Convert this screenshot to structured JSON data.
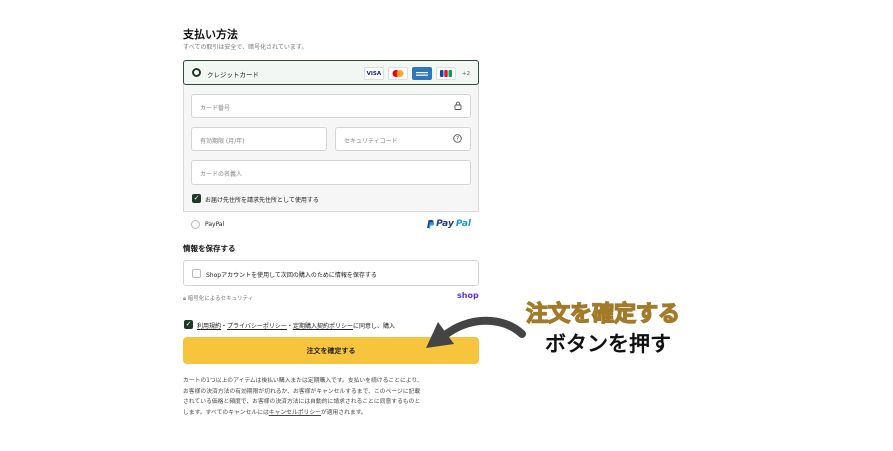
{
  "payment": {
    "title": "支払い方法",
    "subtitle": "すべての取引は安全で、暗号化されています。",
    "credit_card_label": "クレジットカード",
    "card_logos": [
      "VISA",
      "MC",
      "AMEX",
      "JCB"
    ],
    "more_cards": "+2",
    "card_number_placeholder": "カード番号",
    "expiry_placeholder": "有効期限 (月/年)",
    "security_code_placeholder": "セキュリティコード",
    "name_placeholder": "カードの名義人",
    "billing_same_label": "お届け先住所を請求先住所として使用する",
    "paypal_label": "PayPal",
    "paypal_logo_pay": "Pay",
    "paypal_logo_pal": "Pal"
  },
  "save_info": {
    "title": "情報を保存する",
    "checkbox_label": "Shopアカウントを使用して次回の購入のために情報を保存する",
    "secure_note": "暗号化によるセキュリティ",
    "shop_logo": "shop"
  },
  "terms": {
    "link1": "利用規約",
    "sep1": "・",
    "link2": "プライバシーポリシー",
    "sep2": "・",
    "link3": "定期購入契約ポリシー",
    "rest": "に同意し、購入"
  },
  "order_button_label": "注文を確定する",
  "notice": {
    "line1": "カートの1つ以上のアイテムは後払い購入または定期購入です。支払いを続けることにより、",
    "line2": "お客様の決済方法の有効期限が切れるか、お客様がキャンセルするまで、このページに記載",
    "line3": "されている価格と頻度で、お客様の決済方法には自動的に請求されることに同意するものと",
    "line4_pre": "します。すべてのキャンセルには",
    "line4_link": "キャンセルポリシー",
    "line4_post": "が適用されます。"
  },
  "annotation": {
    "line1": "注文を確定する",
    "line2": "ボタンを押す"
  },
  "colors": {
    "accent_dark_green": "#1d3a29",
    "button_yellow": "#f7c53d",
    "annotation_gold": "#f0c36a",
    "shop_purple": "#5a31f4"
  }
}
